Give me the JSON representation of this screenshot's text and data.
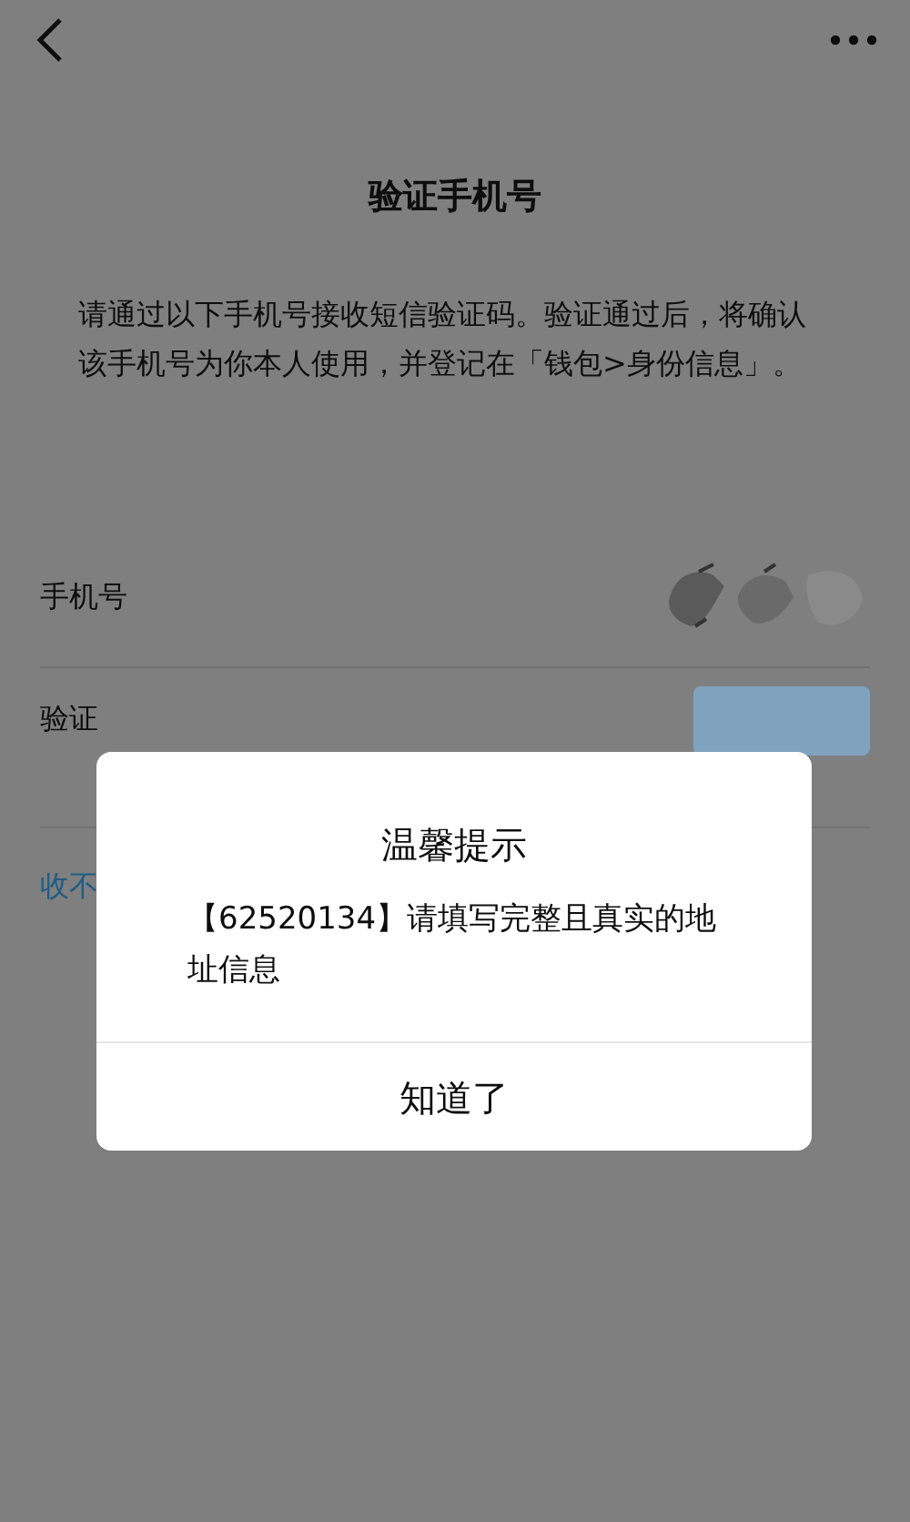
{
  "nav": {
    "title": "验证手机号"
  },
  "description": "请通过以下手机号接收短信验证码。验证通过后，将确认该手机号为你本人使用，并登记在「钱包>身份信息」。",
  "rows": [
    {
      "kind": "phone",
      "label": "手机号"
    },
    {
      "kind": "code",
      "label": "验证"
    }
  ],
  "link": "收不",
  "dialog": {
    "title": "温馨提示",
    "message": "【62520134】请填写完整且真实的地址信息",
    "button": "知道了"
  }
}
